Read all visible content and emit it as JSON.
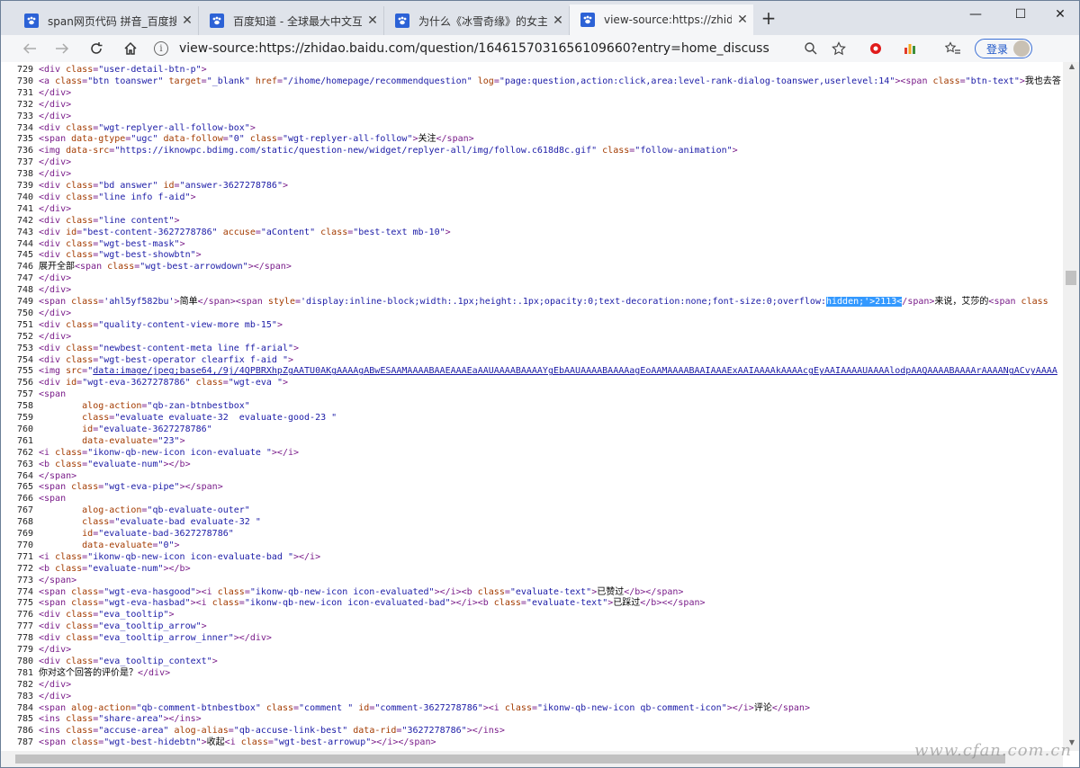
{
  "tabs": [
    {
      "title": "span网页代码 拼音_百度搜索",
      "close": "✕",
      "icon": "paw-icon"
    },
    {
      "title": "百度知道 - 全球最大中文互动问答",
      "close": "✕",
      "icon": "paw-icon"
    },
    {
      "title": "为什么《冰雪奇缘》的女主是Ann",
      "close": "✕",
      "icon": "paw-icon"
    },
    {
      "title": "view-source:https://zhidao.baidu",
      "close": "✕",
      "icon": "paw-icon"
    }
  ],
  "new_tab": "+",
  "window_controls": {
    "minimize": "—",
    "maximize": "☐",
    "close": "✕"
  },
  "toolbar": {
    "url": "view-source:https://zhidao.baidu.com/question/1646157031656109660?entry=home_discuss",
    "login_label": "登录"
  },
  "colors": {
    "accent": "#3a6fd6",
    "tag": "#7a1d8a",
    "attr": "#a33b00",
    "value": "#1a1aa6",
    "highlight": "#3399ff"
  },
  "source_lines": [
    {
      "n": "729",
      "html": "<span class=t>&lt;div </span><span class=a>class</span><span class=t>=</span><span class=v>\"user-detail-btn-p\"</span><span class=t>&gt;</span>"
    },
    {
      "n": "730",
      "html": "<span class=t>&lt;a </span><span class=a>class</span><span class=t>=</span><span class=v>\"btn toanswer\"</span><span class=a> target</span><span class=t>=</span><span class=v>\"_blank\"</span><span class=a> href</span><span class=t>=</span><span class=v>\"/ihome/homepage/recommendquestion\"</span><span class=a> log</span><span class=t>=</span><span class=v>\"page:question,action:click,area:level-rank-dialog-toanswer,userlevel:14\"</span><span class=t>&gt;&lt;span </span><span class=a>class</span><span class=t>=</span><span class=v>\"btn-text\"</span><span class=t>&gt;</span><span class=x>我也去答</span>"
    },
    {
      "n": "731",
      "html": "<span class=t>&lt;/div&gt;</span>"
    },
    {
      "n": "732",
      "html": "<span class=t>&lt;/div&gt;</span>"
    },
    {
      "n": "733",
      "html": "<span class=t>&lt;/div&gt;</span>"
    },
    {
      "n": "734",
      "html": "<span class=t>&lt;div </span><span class=a>class</span><span class=t>=</span><span class=v>\"wgt-replyer-all-follow-box\"</span><span class=t>&gt;</span>"
    },
    {
      "n": "735",
      "html": "<span class=t>&lt;span </span><span class=a>data-gtype</span><span class=t>=</span><span class=v>\"ugc\"</span><span class=a> data-follow</span><span class=t>=</span><span class=v>\"0\"</span><span class=a> class</span><span class=t>=</span><span class=v>\"wgt-replyer-all-follow\"</span><span class=t>&gt;</span><span class=x>关注</span><span class=t>&lt;/span&gt;</span>"
    },
    {
      "n": "736",
      "html": "<span class=t>&lt;img </span><span class=a>data-src</span><span class=t>=</span><span class=v>\"https://iknowpc.bdimg.com/static/question-new/widget/replyer-all/img/follow.c618d8c.gif\"</span><span class=a> class</span><span class=t>=</span><span class=v>\"follow-animation\"</span><span class=t>&gt;</span>"
    },
    {
      "n": "737",
      "html": "<span class=t>&lt;/div&gt;</span>"
    },
    {
      "n": "738",
      "html": "<span class=t>&lt;/div&gt;</span>"
    },
    {
      "n": "739",
      "html": "<span class=t>&lt;div </span><span class=a>class</span><span class=t>=</span><span class=v>\"bd answer\"</span><span class=a> id</span><span class=t>=</span><span class=v>\"answer-3627278786\"</span><span class=t>&gt;</span>"
    },
    {
      "n": "740",
      "html": "<span class=t>&lt;div </span><span class=a>class</span><span class=t>=</span><span class=v>\"line info f-aid\"</span><span class=t>&gt;</span>"
    },
    {
      "n": "741",
      "html": "<span class=t>&lt;/div&gt;</span>"
    },
    {
      "n": "742",
      "html": "<span class=t>&lt;div </span><span class=a>class</span><span class=t>=</span><span class=v>\"line content\"</span><span class=t>&gt;</span>"
    },
    {
      "n": "743",
      "html": "<span class=t>&lt;div </span><span class=a>id</span><span class=t>=</span><span class=v>\"best-content-3627278786\"</span><span class=a> accuse</span><span class=t>=</span><span class=v>\"aContent\"</span><span class=a> class</span><span class=t>=</span><span class=v>\"best-text mb-10\"</span><span class=t>&gt;</span>"
    },
    {
      "n": "744",
      "html": "<span class=t>&lt;div </span><span class=a>class</span><span class=t>=</span><span class=v>\"wgt-best-mask\"</span><span class=t>&gt;</span>"
    },
    {
      "n": "745",
      "html": "<span class=t>&lt;div </span><span class=a>class</span><span class=t>=</span><span class=v>\"wgt-best-showbtn\"</span><span class=t>&gt;</span>"
    },
    {
      "n": "746",
      "html": "<span class=x>展开全部</span><span class=t>&lt;span </span><span class=a>class</span><span class=t>=</span><span class=v>\"wgt-best-arrowdown\"</span><span class=t>&gt;&lt;/span&gt;</span>"
    },
    {
      "n": "747",
      "html": "<span class=t>&lt;/div&gt;</span>"
    },
    {
      "n": "748",
      "html": "<span class=t>&lt;/div&gt;</span>"
    },
    {
      "n": "749",
      "html": "<span class=t>&lt;span </span><span class=a>class</span><span class=t>=</span><span class=v>'ahl5yf582bu'</span><span class=t>&gt;</span><span class=x>简单</span><span class=t>&lt;/span&gt;&lt;span </span><span class=a>style</span><span class=t>=</span><span class=v>'display:inline-block;width:.1px;height:.1px;opacity:0;text-decoration:none;font-size:0;overflow:<span class=hl>hidden;'&gt;2113&lt;</span></span><span class=t>/span&gt;</span><span class=x>来说，艾莎的</span><span class=t>&lt;span </span><span class=a>class</span>"
    },
    {
      "n": "750",
      "html": "<span class=t>&lt;/div&gt;</span>"
    },
    {
      "n": "751",
      "html": "<span class=t>&lt;div </span><span class=a>class</span><span class=t>=</span><span class=v>\"quality-content-view-more mb-15\"</span><span class=t>&gt;</span>"
    },
    {
      "n": "752",
      "html": "<span class=t>&lt;/div&gt;</span>"
    },
    {
      "n": "753",
      "html": "<span class=t>&lt;div </span><span class=a>class</span><span class=t>=</span><span class=v>\"newbest-content-meta line ff-arial\"</span><span class=t>&gt;</span>"
    },
    {
      "n": "754",
      "html": "<span class=t>&lt;div </span><span class=a>class</span><span class=t>=</span><span class=v>\"wgt-best-operator clearfix f-aid \"</span><span class=t>&gt;</span>"
    },
    {
      "n": "755",
      "html": "<span class=t>&lt;img </span><span class=a>src</span><span class=t>=</span><span class=v>\"<span class=lnk>data:image/jpeg;base64,/9j/4QPBRXhpZgAATU0AKgAAAAgABwESAAMAAAABAAEAAAEaAAUAAAABAAAAYgEbAAUAAAABAAAAagEoAAMAAAABAAIAAAExAAIAAAAkAAAAcgEyAAIAAAAUAAAAlodpAAQAAAABAAAArAAAANgACvyAAAA</span></span>"
    },
    {
      "n": "756",
      "html": "<span class=t>&lt;div </span><span class=a>id</span><span class=t>=</span><span class=v>\"wgt-eva-3627278786\"</span><span class=a> class</span><span class=t>=</span><span class=v>\"wgt-eva \"</span><span class=t>&gt;</span>"
    },
    {
      "n": "757",
      "html": "<span class=t>&lt;span</span>"
    },
    {
      "n": "758",
      "html": "<span class=a>        alog-action</span><span class=t>=</span><span class=v>\"qb-zan-btnbestbox\"</span>"
    },
    {
      "n": "759",
      "html": "<span class=a>        class</span><span class=t>=</span><span class=v>\"evaluate evaluate-32  evaluate-good-23 \"</span>"
    },
    {
      "n": "760",
      "html": "<span class=a>        id</span><span class=t>=</span><span class=v>\"evaluate-3627278786\"</span>"
    },
    {
      "n": "761",
      "html": "<span class=a>        data-evaluate</span><span class=t>=</span><span class=v>\"23\"</span><span class=t>&gt;</span>"
    },
    {
      "n": "762",
      "html": "<span class=t>&lt;i </span><span class=a>class</span><span class=t>=</span><span class=v>\"ikonw-qb-new-icon icon-evaluate \"</span><span class=t>&gt;&lt;/i&gt;</span>"
    },
    {
      "n": "763",
      "html": "<span class=t>&lt;b </span><span class=a>class</span><span class=t>=</span><span class=v>\"evaluate-num\"</span><span class=t>&gt;&lt;/b&gt;</span>"
    },
    {
      "n": "764",
      "html": "<span class=t>&lt;/span&gt;</span>"
    },
    {
      "n": "765",
      "html": "<span class=t>&lt;span </span><span class=a>class</span><span class=t>=</span><span class=v>\"wgt-eva-pipe\"</span><span class=t>&gt;&lt;/span&gt;</span>"
    },
    {
      "n": "766",
      "html": "<span class=t>&lt;span</span>"
    },
    {
      "n": "767",
      "html": "<span class=a>        alog-action</span><span class=t>=</span><span class=v>\"qb-evaluate-outer\"</span>"
    },
    {
      "n": "768",
      "html": "<span class=a>        class</span><span class=t>=</span><span class=v>\"evaluate-bad evaluate-32 \"</span>"
    },
    {
      "n": "769",
      "html": "<span class=a>        id</span><span class=t>=</span><span class=v>\"evaluate-bad-3627278786\"</span>"
    },
    {
      "n": "770",
      "html": "<span class=a>        data-evaluate</span><span class=t>=</span><span class=v>\"0\"</span><span class=t>&gt;</span>"
    },
    {
      "n": "771",
      "html": "<span class=t>&lt;i </span><span class=a>class</span><span class=t>=</span><span class=v>\"ikonw-qb-new-icon icon-evaluate-bad \"</span><span class=t>&gt;&lt;/i&gt;</span>"
    },
    {
      "n": "772",
      "html": "<span class=t>&lt;b </span><span class=a>class</span><span class=t>=</span><span class=v>\"evaluate-num\"</span><span class=t>&gt;&lt;/b&gt;</span>"
    },
    {
      "n": "773",
      "html": "<span class=t>&lt;/span&gt;</span>"
    },
    {
      "n": "774",
      "html": "<span class=t>&lt;span </span><span class=a>class</span><span class=t>=</span><span class=v>\"wgt-eva-hasgood\"</span><span class=t>&gt;&lt;i </span><span class=a>class</span><span class=t>=</span><span class=v>\"ikonw-qb-new-icon icon-evaluated\"</span><span class=t>&gt;&lt;/i&gt;&lt;b </span><span class=a>class</span><span class=t>=</span><span class=v>\"evaluate-text\"</span><span class=t>&gt;</span><span class=x>已赞过</span><span class=t>&lt;/b&gt;&lt;/span&gt;</span>"
    },
    {
      "n": "775",
      "html": "<span class=t>&lt;span </span><span class=a>class</span><span class=t>=</span><span class=v>\"wgt-eva-hasbad\"</span><span class=t>&gt;&lt;i </span><span class=a>class</span><span class=t>=</span><span class=v>\"ikonw-qb-new-icon icon-evaluated-bad\"</span><span class=t>&gt;&lt;/i&gt;&lt;b </span><span class=a>class</span><span class=t>=</span><span class=v>\"evaluate-text\"</span><span class=t>&gt;</span><span class=x>已踩过</span><span class=t>&lt;/b&gt;&lt;&lt;/span&gt;</span>"
    },
    {
      "n": "776",
      "html": "<span class=t>&lt;div </span><span class=a>class</span><span class=t>=</span><span class=v>\"eva_tooltip\"</span><span class=t>&gt;</span>"
    },
    {
      "n": "777",
      "html": "<span class=t>&lt;div </span><span class=a>class</span><span class=t>=</span><span class=v>\"eva_tooltip_arrow\"</span><span class=t>&gt;</span>"
    },
    {
      "n": "778",
      "html": "<span class=t>&lt;div </span><span class=a>class</span><span class=t>=</span><span class=v>\"eva_tooltip_arrow_inner\"</span><span class=t>&gt;&lt;/div&gt;</span>"
    },
    {
      "n": "779",
      "html": "<span class=t>&lt;/div&gt;</span>"
    },
    {
      "n": "780",
      "html": "<span class=t>&lt;div </span><span class=a>class</span><span class=t>=</span><span class=v>\"eva_tooltip_context\"</span><span class=t>&gt;</span>"
    },
    {
      "n": "781",
      "html": "<span class=x>你对这个回答的评价是？</span><span class=t>&lt;/div&gt;</span>"
    },
    {
      "n": "782",
      "html": "<span class=t>&lt;/div&gt;</span>"
    },
    {
      "n": "783",
      "html": "<span class=t>&lt;/div&gt;</span>"
    },
    {
      "n": "784",
      "html": "<span class=t>&lt;span </span><span class=a>alog-action</span><span class=t>=</span><span class=v>\"qb-comment-btnbestbox\"</span><span class=a> class</span><span class=t>=</span><span class=v>\"comment \"</span><span class=a> id</span><span class=t>=</span><span class=v>\"comment-3627278786\"</span><span class=t>&gt;&lt;i </span><span class=a>class</span><span class=t>=</span><span class=v>\"ikonw-qb-new-icon qb-comment-icon\"</span><span class=t>&gt;&lt;/i&gt;</span><span class=x>评论</span><span class=t>&lt;/span&gt;</span>"
    },
    {
      "n": "785",
      "html": "<span class=t>&lt;ins </span><span class=a>class</span><span class=t>=</span><span class=v>\"share-area\"</span><span class=t>&gt;&lt;/ins&gt;</span>"
    },
    {
      "n": "786",
      "html": "<span class=t>&lt;ins </span><span class=a>class</span><span class=t>=</span><span class=v>\"accuse-area\"</span><span class=a> alog-alias</span><span class=t>=</span><span class=v>\"qb-accuse-link-best\"</span><span class=a> data-rid</span><span class=t>=</span><span class=v>\"3627278786\"</span><span class=t>&gt;&lt;/ins&gt;</span>"
    },
    {
      "n": "787",
      "html": "<span class=t>&lt;span </span><span class=a>class</span><span class=t>=</span><span class=v>\"wgt-best-hidebtn\"</span><span class=t>&gt;</span><span class=x>收起</span><span class=t>&lt;i </span><span class=a>class</span><span class=t>=</span><span class=v>\"wgt-best-arrowup\"</span><span class=t>&gt;&lt;/i&gt;&lt;/span&gt;</span>"
    }
  ],
  "watermark": "www.cfan.com.cn"
}
